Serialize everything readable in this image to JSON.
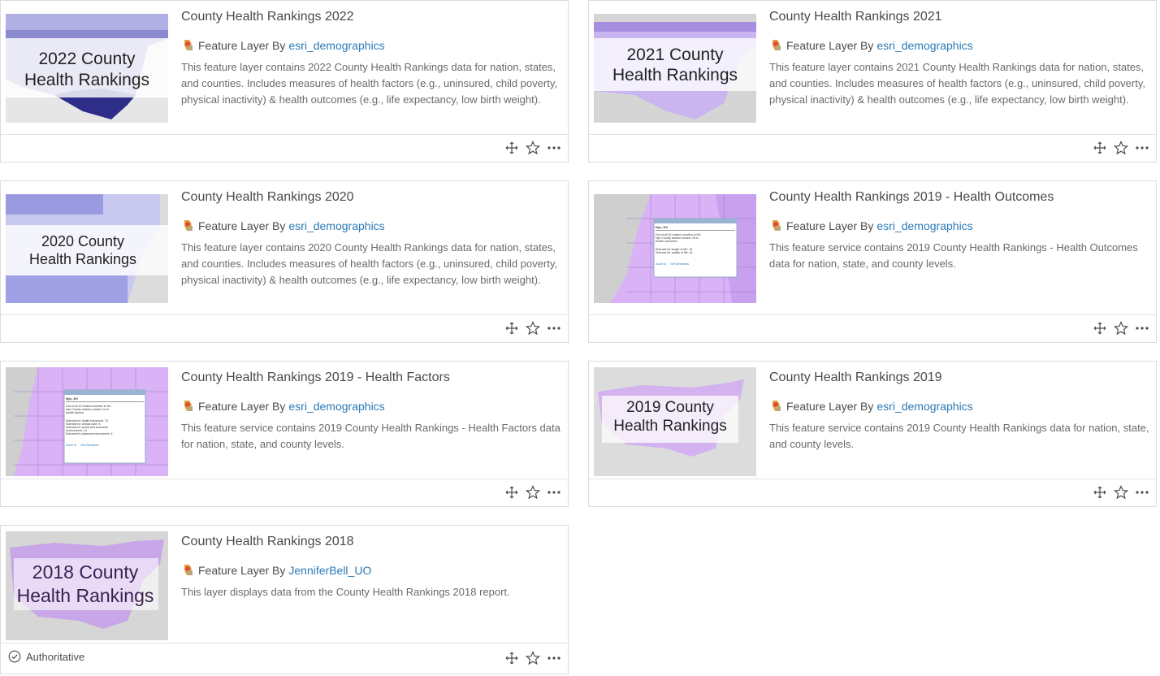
{
  "cards": [
    {
      "title": "County Health Rankings 2022",
      "type_label": "Feature Layer By",
      "owner": "esri_demographics",
      "description": "This feature layer contains 2022 County Health Rankings data for nation, states, and counties. Includes measures of health factors (e.g., uninsured, child poverty, physical inactivity) & health outcomes (e.g., life expectancy, low birth weight).",
      "thumb_line1": "2022 County",
      "thumb_line2": "Health Rankings"
    },
    {
      "title": "County Health Rankings 2021",
      "type_label": "Feature Layer By",
      "owner": "esri_demographics",
      "description": "This feature layer contains 2021 County Health Rankings data for nation, states, and counties. Includes measures of health factors (e.g., uninsured, child poverty, physical inactivity) & health outcomes (e.g., life expectancy, low birth weight).",
      "thumb_line1": "2021 County",
      "thumb_line2": "Health Rankings"
    },
    {
      "title": "County Health Rankings 2020",
      "type_label": "Feature Layer By",
      "owner": "esri_demographics",
      "description": "This feature layer contains 2020 County Health Rankings data for nation, states, and counties. Includes measures of health factors (e.g., uninsured, child poverty, physical inactivity) & health outcomes (e.g., life expectancy, low birth weight).",
      "thumb_line1": "2020 County",
      "thumb_line2": "Health Rankings"
    },
    {
      "title": "County Health Rankings 2019 - Health Outcomes",
      "type_label": "Feature Layer By",
      "owner": "esri_demographics",
      "description": "This feature service contains 2019 County Health Rankings - Health Outcomes data for nation, state, and county levels.",
      "popup": {
        "heading": "Nye, NV",
        "lines": [
          "Out of all 15 ranked counties in NV,",
          "Nye County ranked number 15 in",
          "health outcomes.",
          "",
          "Subrank for length of life: 15",
          "Subrank for quality of life: 14"
        ],
        "link1": "Zoom to",
        "link2": "Get Directions"
      }
    },
    {
      "title": "County Health Rankings 2019 - Health Factors",
      "type_label": "Feature Layer By",
      "owner": "esri_demographics",
      "description": "This feature service contains 2019 County Health Rankings - Health Factors data for nation, state, and county levels.",
      "popup": {
        "heading": "Nye, NV",
        "lines": [
          "Out of all 15 ranked counties in NV,",
          "Nye County ranked number 14 in",
          "health factors.",
          "",
          "Subrank for health behaviors: 13",
          "Subrank for clinical care: 8",
          "Subrank for social and economic",
          "environment: 14",
          "Subrank for physical environment: 9"
        ],
        "link1": "Zoom to",
        "link2": "Get Directions"
      }
    },
    {
      "title": "County Health Rankings 2019",
      "type_label": "Feature Layer By",
      "owner": "esri_demographics",
      "description": "This feature service contains 2019 County Health Rankings data for nation, state, and county levels.",
      "thumb_line1": "2019 County",
      "thumb_line2": "Health Rankings"
    },
    {
      "title": "County Health Rankings 2018",
      "type_label": "Feature Layer By",
      "owner": "JenniferBell_UO",
      "description": "This layer displays data from the County Health Rankings 2018 report.",
      "thumb_line1": "2018 County",
      "thumb_line2": "Health Rankings",
      "badge": "Authoritative"
    }
  ],
  "icons": {
    "type": "feature-layer-icon",
    "move": "move-icon",
    "favorite": "star-icon",
    "more": "more-icon",
    "badge": "check-circle-icon"
  },
  "colors": {
    "link": "#2a7ab6",
    "purple_light": "#d9b3f5",
    "purple_dark": "#1f1f6b"
  }
}
